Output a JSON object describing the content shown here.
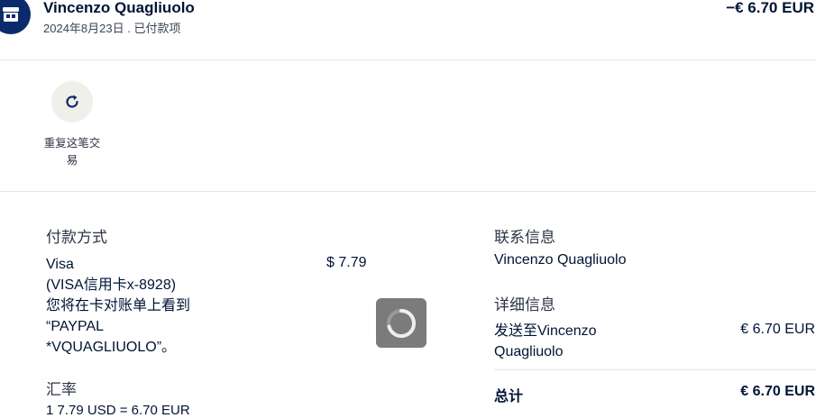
{
  "header": {
    "merchant_icon": "store-icon",
    "merchant_name": "Vincenzo Quagliuolo",
    "subtitle": "2024年8月23日 . 已付款项",
    "amount": "−€ 6.70 EUR"
  },
  "repeat": {
    "icon": "refresh-icon",
    "label": "重复这笔交易"
  },
  "payment": {
    "title": "付款方式",
    "method_lines": [
      "Visa",
      "(VISA信用卡x-8928)",
      "您将在卡对账单上看到",
      "“PAYPAL",
      "*VQUAGLIUOLO”。"
    ],
    "amount": "$ 7.79"
  },
  "exchange": {
    "title": "汇率",
    "value": "1 7.79 USD = 6.70 EUR"
  },
  "contact": {
    "title": "联系信息",
    "name": "Vincenzo Quagliuolo"
  },
  "details": {
    "title": "详细信息",
    "sent_to": "发送至Vincenzo Quagliuolo",
    "sent_amount": "€ 6.70 EUR",
    "total_label": "总计",
    "total_amount": "€ 6.70 EUR"
  },
  "overlay": {
    "icon": "loading-spinner-icon"
  }
}
